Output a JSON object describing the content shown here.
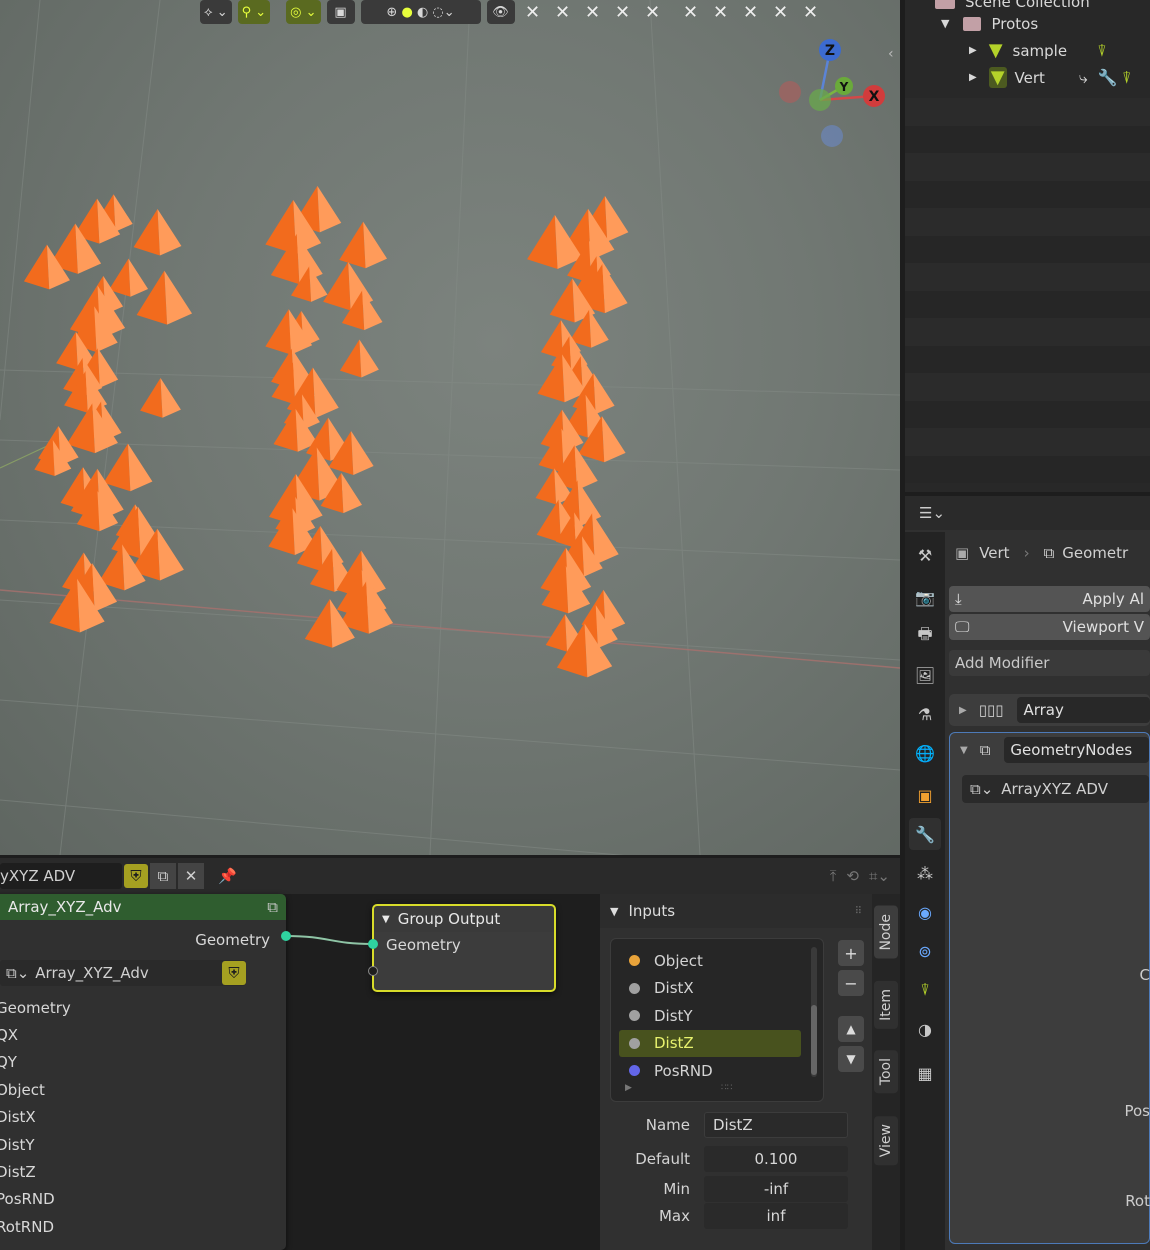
{
  "colors": {
    "cone": "#f26b1d",
    "cone_light": "#ff9b5a",
    "accent_yellow": "#c8e024",
    "selected_blue": "#6aa9ff",
    "socket_green": "#2fd3a0",
    "socket_orange": "#e8a33a",
    "socket_gray": "#a0a0a0",
    "socket_purple": "#6366e8"
  },
  "gizmo": {
    "z": "Z",
    "y": "Y",
    "x": "X"
  },
  "outliner": {
    "scene_collection": "Scene Collection",
    "items": [
      {
        "label": "Protos",
        "icon": "collection-icon"
      },
      {
        "label": "sample",
        "icon": "mesh-icon"
      },
      {
        "label": "Vert",
        "icon": "mesh-icon"
      }
    ]
  },
  "properties": {
    "breadcrumb": {
      "object": "Vert",
      "data": "Geometr"
    },
    "apply_label": "Apply Al",
    "viewport_label": "Viewport V",
    "add_modifier": "Add Modifier",
    "modifiers": [
      {
        "name": "Array"
      },
      {
        "name": "GeometryNodes"
      }
    ],
    "node_group": "ArrayXYZ ADV",
    "cut_labels": {
      "c": "C",
      "pos": "Pos",
      "rot": "Rot"
    }
  },
  "node_editor": {
    "tree_name": "yXYZ ADV",
    "group_node": {
      "title": "Array_XYZ_Adv",
      "output": "Geometry",
      "subgroup": "Array_XYZ_Adv",
      "inputs": [
        "Geometry",
        "QX",
        "QY",
        "Object",
        "DistX",
        "DistY",
        "DistZ",
        "PosRND",
        "RotRND"
      ]
    },
    "output_node": {
      "title": "Group Output",
      "input": "Geometry"
    },
    "sidebar": {
      "section": "Inputs",
      "inputs": [
        {
          "label": "Object",
          "color": "#e8a33a",
          "selected": false
        },
        {
          "label": "DistX",
          "color": "#a0a0a0",
          "selected": false
        },
        {
          "label": "DistY",
          "color": "#a0a0a0",
          "selected": false
        },
        {
          "label": "DistZ",
          "color": "#a0a0a0",
          "selected": true
        },
        {
          "label": "PosRND",
          "color": "#6366e8",
          "selected": false
        }
      ],
      "name_label": "Name",
      "name_value": "DistZ",
      "default_label": "Default",
      "default_value": "0.100",
      "min_label": "Min",
      "min_value": "-inf",
      "max_label": "Max",
      "max_value": "inf"
    },
    "tabs": [
      "Node",
      "Item",
      "Tool",
      "View"
    ]
  }
}
